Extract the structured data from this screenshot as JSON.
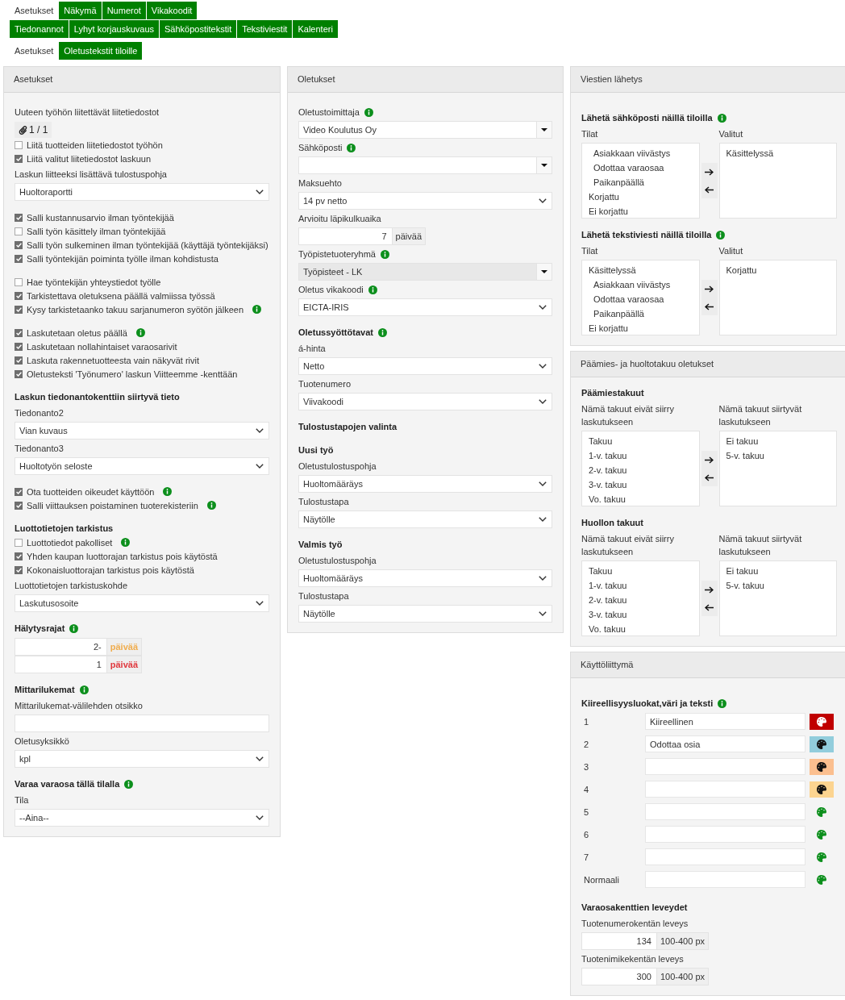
{
  "main_tabs": [
    {
      "tabs": [
        {
          "label": "Asetukset",
          "selected": true
        },
        {
          "label": "Näkymä",
          "selected": false
        },
        {
          "label": "Numerot",
          "selected": false
        },
        {
          "label": "Vikakoodit",
          "selected": false
        }
      ]
    },
    {
      "tabs": [
        {
          "label": "Tiedonannot",
          "selected": false
        },
        {
          "label": "Lyhyt korjauskuvaus",
          "selected": false
        },
        {
          "label": "Sähköpostitekstit",
          "selected": false
        },
        {
          "label": "Tekstiviestit",
          "selected": false
        },
        {
          "label": "Kalenteri",
          "selected": false
        }
      ]
    }
  ],
  "sub_tabs": [
    {
      "label": "Asetukset",
      "selected": true
    },
    {
      "label": "Oletustekstit tiloille",
      "selected": false
    }
  ],
  "columns": [
    {
      "panels": [
        {
          "title": "Asetukset",
          "sections": [
            {
              "items": [
                {
                  "kind": "text",
                  "text": "Uuteen työhön liitettävät liitetiedostot"
                },
                {
                  "kind": "attachment",
                  "text": "1 / 1"
                },
                {
                  "kind": "checkbox",
                  "label": "Liitä tuotteiden liitetiedostot työhön",
                  "checked": false
                },
                {
                  "kind": "checkbox",
                  "label": "Liitä valitut liitetiedostot laskuun",
                  "checked": true
                },
                {
                  "kind": "select",
                  "label": "Laskun liitteeksi lisättävä tulostuspohja",
                  "value": "Huoltoraportti"
                }
              ]
            },
            {
              "items": [
                {
                  "kind": "checkbox",
                  "label": "Salli kustannusarvio ilman työntekijää",
                  "checked": true
                },
                {
                  "kind": "checkbox",
                  "label": "Salli työn käsittely ilman työntekijää",
                  "checked": false
                },
                {
                  "kind": "checkbox",
                  "label": "Salli työn sulkeminen ilman työntekijää (käyttäjä työntekijäksi)",
                  "checked": true
                },
                {
                  "kind": "checkbox",
                  "label": "Salli työntekijän poiminta työlle ilman kohdistusta",
                  "checked": true
                }
              ]
            },
            {
              "items": [
                {
                  "kind": "checkbox",
                  "label": "Hae työntekijän yhteystiedot työlle",
                  "checked": false
                },
                {
                  "kind": "checkbox",
                  "label": "Tarkistettava oletuksena päällä valmiissa työssä",
                  "checked": true
                },
                {
                  "kind": "checkbox",
                  "label": "Kysy tarkistetaanko takuu sarjanumeron syötön jälkeen",
                  "checked": true,
                  "info": true
                }
              ]
            },
            {
              "items": [
                {
                  "kind": "checkbox",
                  "label": "Laskutetaan oletus päällä",
                  "checked": true,
                  "info": true
                },
                {
                  "kind": "checkbox",
                  "label": "Laskutetaan nollahintaiset varaosarivit",
                  "checked": true
                },
                {
                  "kind": "checkbox",
                  "label": "Laskuta rakennetuotteesta vain näkyvät rivit",
                  "checked": true
                },
                {
                  "kind": "checkbox",
                  "label": "Oletusteksti 'Työnumero' laskun Viitteemme -kenttään",
                  "checked": true
                }
              ]
            },
            {
              "items": [
                {
                  "kind": "heading",
                  "text": "Laskun tiedonantokenttiin siirtyvä tieto"
                },
                {
                  "kind": "select",
                  "label": "Tiedonanto2",
                  "value": "Vian kuvaus"
                },
                {
                  "kind": "select",
                  "label": "Tiedonanto3",
                  "value": "Huoltotyön seloste"
                }
              ]
            },
            {
              "items": [
                {
                  "kind": "checkbox",
                  "label": "Ota tuotteiden oikeudet käyttöön",
                  "checked": true,
                  "info": true
                },
                {
                  "kind": "checkbox",
                  "label": "Salli viittauksen poistaminen tuoterekisteriin",
                  "checked": true,
                  "info": true
                }
              ]
            },
            {
              "items": [
                {
                  "kind": "heading",
                  "text": "Luottotietojen tarkistus"
                },
                {
                  "kind": "checkbox",
                  "label": "Luottotiedot pakolliset",
                  "checked": false,
                  "info": true
                },
                {
                  "kind": "checkbox",
                  "label": "Yhden kaupan luottorajan tarkistus pois käytöstä",
                  "checked": true
                },
                {
                  "kind": "checkbox",
                  "label": "Kokonaisluottorajan tarkistus pois käytöstä",
                  "checked": true
                },
                {
                  "kind": "select",
                  "label": "Luottotietojen tarkistuskohde",
                  "value": "Laskutusosoite"
                }
              ]
            },
            {
              "items": [
                {
                  "kind": "heading",
                  "text": "Hälytysrajat",
                  "info": true
                },
                {
                  "kind": "addon",
                  "value": "2-",
                  "unit": "päivää",
                  "color": "#f0ad4e"
                },
                {
                  "kind": "addon",
                  "value": "1",
                  "unit": "päivää",
                  "color": "#e0383e"
                }
              ]
            },
            {
              "items": [
                {
                  "kind": "heading",
                  "text": "Mittarilukemat",
                  "info": true
                },
                {
                  "kind": "input",
                  "label": "Mittarilukemat-välilehden otsikko"
                },
                {
                  "kind": "select",
                  "label": "Oletusyksikkö",
                  "value": "kpl"
                }
              ]
            },
            {
              "items": [
                {
                  "kind": "heading",
                  "text": "Varaa varaosa tällä tilalla",
                  "info": true
                },
                {
                  "kind": "select",
                  "label": "Tila",
                  "value": "--Aina--"
                }
              ]
            }
          ]
        }
      ]
    },
    {
      "panels": [
        {
          "title": "Oletukset",
          "sections": [
            {
              "items": [
                {
                  "kind": "combo",
                  "label": "Oletustoimittaja",
                  "info": true,
                  "value": "Video Koulutus Oy",
                  "disabled": false
                },
                {
                  "kind": "combo",
                  "label": "Sähköposti",
                  "info": true,
                  "disabled": false
                },
                {
                  "kind": "select",
                  "label": "Maksuehto",
                  "value": "14 pv netto"
                },
                {
                  "kind": "addon",
                  "label": "Arvioitu läpikulkuaika",
                  "value": "7",
                  "unit": "päivää"
                },
                {
                  "kind": "combo",
                  "label": "Työpistetuoteryhmä",
                  "info": true,
                  "value": "Työpisteet - LK",
                  "disabled": true
                },
                {
                  "kind": "select",
                  "label": "Oletus vikakoodi",
                  "info": true,
                  "value": "EICTA-IRIS"
                }
              ]
            },
            {
              "items": [
                {
                  "kind": "heading",
                  "text": "Oletussyöttötavat",
                  "info": true
                },
                {
                  "kind": "select",
                  "label": "á-hinta",
                  "value": "Netto"
                },
                {
                  "kind": "select",
                  "label": "Tuotenumero",
                  "value": "Viivakoodi"
                }
              ]
            },
            {
              "items": [
                {
                  "kind": "heading",
                  "text": "Tulostustapojen valinta"
                }
              ]
            },
            {
              "items": [
                {
                  "kind": "heading",
                  "text": "Uusi työ"
                },
                {
                  "kind": "select",
                  "label": "Oletustulostuspohja",
                  "value": "Huoltomääräys"
                },
                {
                  "kind": "select",
                  "label": "Tulostustapa",
                  "value": "Näytölle"
                }
              ]
            },
            {
              "items": [
                {
                  "kind": "heading",
                  "text": "Valmis työ"
                },
                {
                  "kind": "select",
                  "label": "Oletustulostuspohja",
                  "value": "Huoltomääräys"
                },
                {
                  "kind": "select",
                  "label": "Tulostustapa",
                  "value": "Näytölle"
                }
              ]
            }
          ]
        }
      ]
    },
    {
      "panels": [
        {
          "title": "Viestien lähetys",
          "sections": [
            {
              "items": [
                {
                  "kind": "heading",
                  "text": "Lähetä sähköposti näillä tiloilla",
                  "info": true
                },
                {
                  "kind": "transfer",
                  "left_label": "Tilat",
                  "right_label": "Valitut",
                  "available": [
                    {
                      "label": "Asiakkaan viivästys",
                      "kind": "sub",
                      "selected": false
                    },
                    {
                      "label": "Odottaa varaosaa",
                      "kind": "sub",
                      "selected": false
                    },
                    {
                      "label": "Paikanpäällä",
                      "kind": "sub",
                      "selected": false
                    },
                    {
                      "label": "Korjattu",
                      "kind": "main",
                      "selected": false
                    },
                    {
                      "label": "Ei korjattu",
                      "kind": "main",
                      "selected": false
                    }
                  ],
                  "chosen": [
                    {
                      "label": "Käsittelyssä",
                      "kind": "main",
                      "selected": false
                    }
                  ]
                }
              ]
            },
            {
              "items": [
                {
                  "kind": "heading",
                  "text": "Lähetä tekstiviesti näillä tiloilla",
                  "info": true
                },
                {
                  "kind": "transfer",
                  "left_label": "Tilat",
                  "right_label": "Valitut",
                  "available": [
                    {
                      "label": "Käsittelyssä",
                      "kind": "main",
                      "selected": false
                    },
                    {
                      "label": "Asiakkaan viivästys",
                      "kind": "sub",
                      "selected": false
                    },
                    {
                      "label": "Odottaa varaosaa",
                      "kind": "sub",
                      "selected": false
                    },
                    {
                      "label": "Paikanpäällä",
                      "kind": "sub",
                      "selected": false
                    },
                    {
                      "label": "Ei korjattu",
                      "kind": "main",
                      "selected": false
                    }
                  ],
                  "chosen": [
                    {
                      "label": "Korjattu",
                      "kind": "main",
                      "selected": false
                    }
                  ]
                }
              ]
            }
          ]
        },
        {
          "title": "Päämies- ja huoltotakuu oletukset",
          "sections": [
            {
              "items": [
                {
                  "kind": "heading",
                  "text": "Päämiestakuut"
                },
                {
                  "kind": "transfer",
                  "left_label": "Nämä takuut eivät siirry laskutukseen",
                  "right_label": "Nämä takuut siirtyvät laskutukseen",
                  "available": [
                    {
                      "label": "Takuu",
                      "kind": "main",
                      "selected": false
                    },
                    {
                      "label": "1-v. takuu",
                      "kind": "main",
                      "selected": false
                    },
                    {
                      "label": "2-v. takuu",
                      "kind": "main",
                      "selected": false
                    },
                    {
                      "label": "3-v. takuu",
                      "kind": "main",
                      "selected": false
                    },
                    {
                      "label": "Vo. takuu",
                      "kind": "main",
                      "selected": false
                    }
                  ],
                  "chosen": [
                    {
                      "label": "Ei takuu",
                      "kind": "main",
                      "selected": false
                    },
                    {
                      "label": "5-v. takuu",
                      "kind": "main",
                      "selected": false
                    }
                  ]
                }
              ]
            },
            {
              "items": [
                {
                  "kind": "heading",
                  "text": "Huollon takuut"
                },
                {
                  "kind": "transfer",
                  "left_label": "Nämä takuut eivät siirry laskutukseen",
                  "right_label": "Nämä takuut siirtyvät laskutukseen",
                  "available": [
                    {
                      "label": "Takuu",
                      "kind": "main",
                      "selected": false
                    },
                    {
                      "label": "1-v. takuu",
                      "kind": "main",
                      "selected": false
                    },
                    {
                      "label": "2-v. takuu",
                      "kind": "main",
                      "selected": false
                    },
                    {
                      "label": "3-v. takuu",
                      "kind": "main",
                      "selected": false
                    },
                    {
                      "label": "Vo. takuu",
                      "kind": "main",
                      "selected": false
                    }
                  ],
                  "chosen": [
                    {
                      "label": "Ei takuu",
                      "kind": "main",
                      "selected": false
                    },
                    {
                      "label": "5-v. takuu",
                      "kind": "main",
                      "selected": false
                    }
                  ]
                }
              ]
            }
          ]
        },
        {
          "title": "Käyttöliittymä",
          "sections": [
            {
              "items": [
                {
                  "kind": "heading",
                  "text": "Kiireellisyysluokat,väri ja teksti",
                  "info": true
                },
                {
                  "kind": "urgency",
                  "label": "1",
                  "value": "Kiireellinen",
                  "color": "#c00000"
                },
                {
                  "kind": "urgency",
                  "label": "2",
                  "value": "Odottaa osia",
                  "color": "#92cddc"
                },
                {
                  "kind": "urgency",
                  "label": "3",
                  "color": "#fbbf8f"
                },
                {
                  "kind": "urgency",
                  "label": "4",
                  "color": "#fcd490"
                },
                {
                  "kind": "urgency",
                  "label": "5"
                },
                {
                  "kind": "urgency",
                  "label": "6"
                },
                {
                  "kind": "urgency",
                  "label": "7"
                },
                {
                  "kind": "urgency",
                  "label": "Normaali"
                }
              ]
            },
            {
              "items": [
                {
                  "kind": "heading",
                  "text": "Varaosakenttien leveydet"
                },
                {
                  "kind": "addon",
                  "label": "Tuotenumerokentän leveys",
                  "value": "134",
                  "unit": "100-400 px"
                },
                {
                  "kind": "addon",
                  "label": "Tuotenimikekentän leveys",
                  "value": "300",
                  "unit": "100-400 px"
                }
              ]
            }
          ]
        }
      ]
    }
  ]
}
